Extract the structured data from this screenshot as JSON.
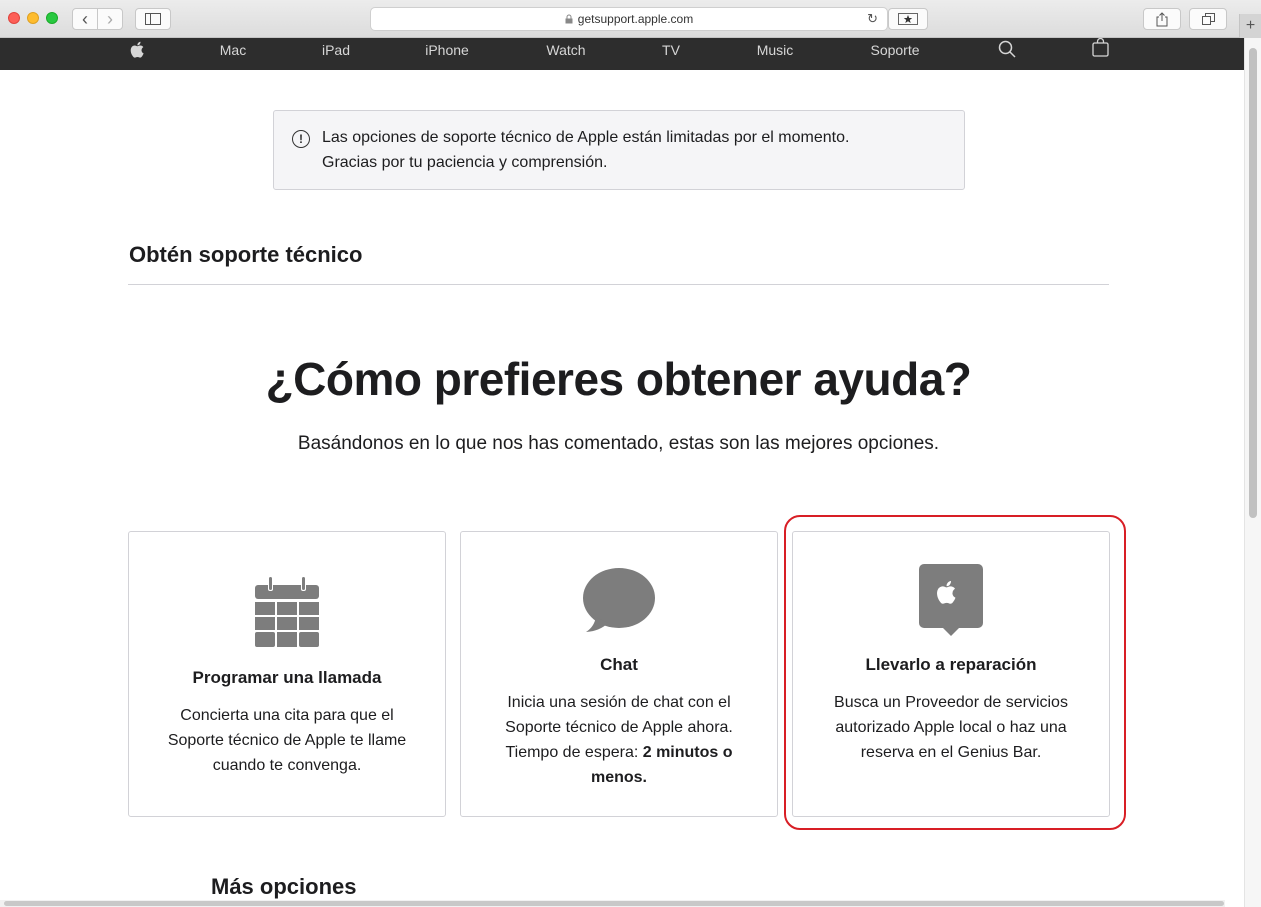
{
  "browser": {
    "url": "getsupport.apple.com",
    "back_glyph": "‹",
    "forward_glyph": "›",
    "reload_glyph": "↻",
    "new_tab_glyph": "+"
  },
  "nav": {
    "items": [
      "Mac",
      "iPad",
      "iPhone",
      "Watch",
      "TV",
      "Music",
      "Soporte"
    ]
  },
  "alert": {
    "line1": "Las opciones de soporte técnico de Apple están limitadas por el momento.",
    "line2": "Gracias por tu paciencia y comprensión.",
    "icon": "!"
  },
  "section_title": "Obtén soporte técnico",
  "hero": {
    "title": "¿Cómo prefieres obtener ayuda?",
    "subtitle": "Basándonos en lo que nos has comentado, estas son las mejores opciones."
  },
  "cards": [
    {
      "icon": "calendar-icon",
      "title": "Programar una llamada",
      "desc_lines": [
        "Concierta una cita para que el",
        "Soporte técnico de Apple te llame",
        "cuando te convenga."
      ]
    },
    {
      "icon": "chat-bubble-icon",
      "title": "Chat",
      "desc_lines": [
        "Inicia una sesión de chat con el",
        "Soporte técnico de Apple ahora."
      ],
      "wait_prefix": "Tiempo de espera: ",
      "wait_bold": "2 minutos o",
      "wait_bold2": "menos."
    },
    {
      "icon": "apple-store-icon",
      "title": "Llevarlo a reparación",
      "desc_lines": [
        "Busca un Proveedor de servicios",
        "autorizado Apple local o haz una",
        "reserva en el Genius Bar."
      ],
      "highlighted": true
    }
  ],
  "more_title": "Más opciones",
  "colors": {
    "nav_bg": "#2d2d2d",
    "highlight": "#d81e25",
    "icon_gray": "#7d7d7d"
  }
}
